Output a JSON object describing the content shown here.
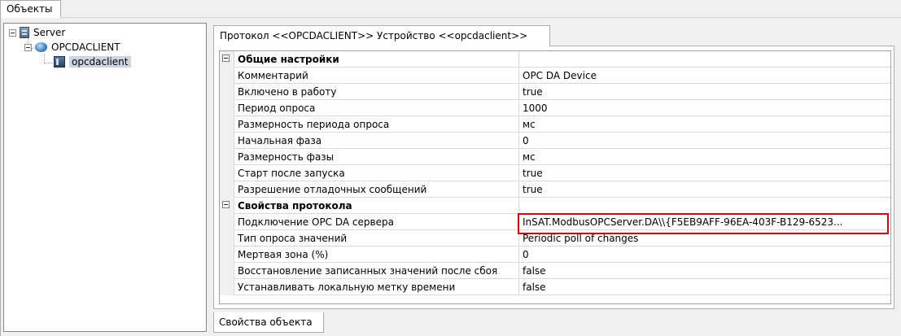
{
  "top_tab": {
    "label": "Объекты"
  },
  "tree": {
    "nodes": [
      {
        "label": "Server",
        "icon": "server-icon"
      },
      {
        "label": "OPCDACLIENT",
        "icon": "protocol-icon"
      },
      {
        "label": "opcdaclient",
        "icon": "device-icon"
      }
    ]
  },
  "right_tab": {
    "label": "Протокол <<OPCDACLIENT>> Устройство <<opcdaclient>>"
  },
  "grid": {
    "rows": [
      {
        "name": "Общие настройки",
        "value": ""
      },
      {
        "name": "Комментарий",
        "value": "OPC DA Device"
      },
      {
        "name": "Включено в работу",
        "value": "true"
      },
      {
        "name": "Период опроса",
        "value": "1000"
      },
      {
        "name": "Размерность периода опроса",
        "value": "мс"
      },
      {
        "name": "Начальная фаза",
        "value": "0"
      },
      {
        "name": "Размерность фазы",
        "value": "мс"
      },
      {
        "name": "Старт после запуска",
        "value": "true"
      },
      {
        "name": "Разрешение отладочных сообщений",
        "value": "true"
      },
      {
        "name": "Свойства протокола",
        "value": ""
      },
      {
        "name": "Подключение OPC DA сервера",
        "value": "InSAT.ModbusOPCServer.DA\\\\{F5EB9AFF-96EA-403F-B129-6523..."
      },
      {
        "name": "Тип опроса значений",
        "value": "Periodic poll of changes"
      },
      {
        "name": "Мертвая зона (%)",
        "value": "0"
      },
      {
        "name": "Восстановление записанных значений после сбоя",
        "value": "false"
      },
      {
        "name": "Устанавливать локальную метку времени",
        "value": "false"
      }
    ]
  },
  "highlight_color": "#e00000",
  "bottom_tab": {
    "label": "Свойства объекта"
  }
}
